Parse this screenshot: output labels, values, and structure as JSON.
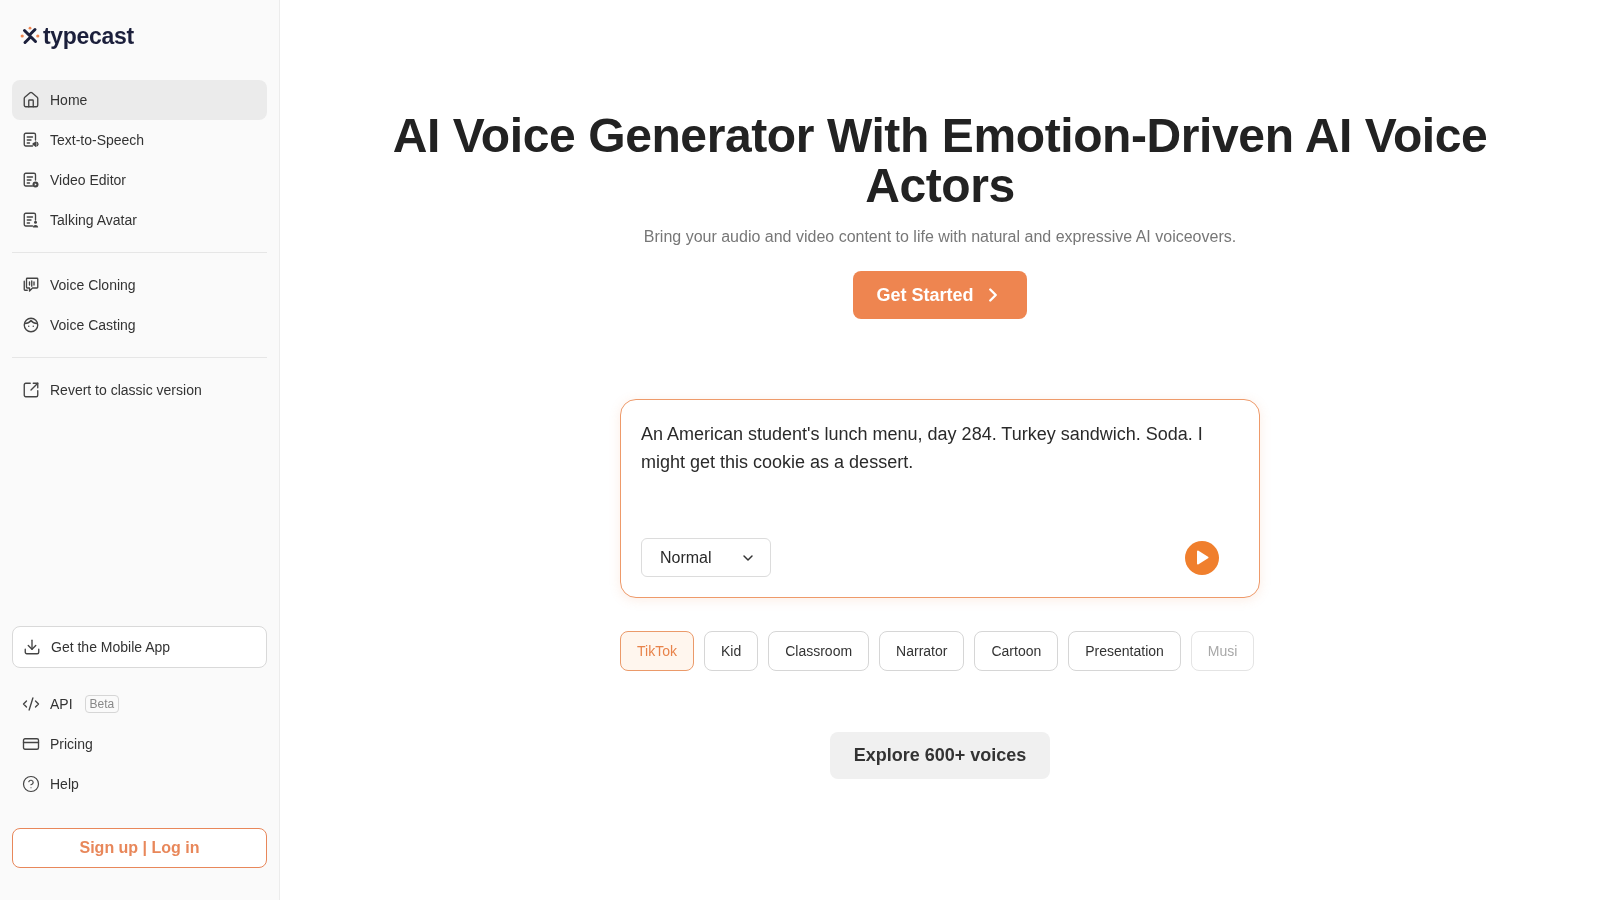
{
  "sidebar": {
    "logo": {
      "wordmark": "typecast"
    },
    "nav_sections": [
      {
        "items": [
          {
            "label": "Home",
            "selected": true
          },
          {
            "label": "Text-to-Speech",
            "selected": false
          },
          {
            "label": "Video Editor",
            "selected": false
          },
          {
            "label": "Talking Avatar",
            "selected": false
          }
        ]
      },
      {
        "items": [
          {
            "label": "Voice Cloning",
            "selected": false
          },
          {
            "label": "Voice Casting",
            "selected": false
          }
        ]
      },
      {
        "items": [
          {
            "label": "Revert to classic version",
            "selected": false
          }
        ]
      }
    ],
    "mobile_app_button": "Get the Mobile App",
    "links": [
      {
        "label": "API",
        "tag": "Beta"
      },
      {
        "label": "Pricing"
      },
      {
        "label": "Help"
      }
    ],
    "auth_button": "Sign up | Log in"
  },
  "hero": {
    "title": "AI Voice Generator With Emotion-Driven AI Voice Actors",
    "subtitle": "Bring your audio and video content to life with natural and expressive AI voiceovers.",
    "cta": "Get Started"
  },
  "demo": {
    "text": "An American student's lunch menu, day 284. Turkey sandwich. Soda. I might get this cookie as a dessert.",
    "style_select": "Normal"
  },
  "presets": [
    {
      "label": "TikTok",
      "selected": true
    },
    {
      "label": "Kid",
      "selected": false
    },
    {
      "label": "Classroom",
      "selected": false
    },
    {
      "label": "Narrator",
      "selected": false
    },
    {
      "label": "Cartoon",
      "selected": false
    },
    {
      "label": "Presentation",
      "selected": false
    },
    {
      "label": "Musi",
      "selected": false
    }
  ],
  "explore_button": "Explore 600+ voices"
}
